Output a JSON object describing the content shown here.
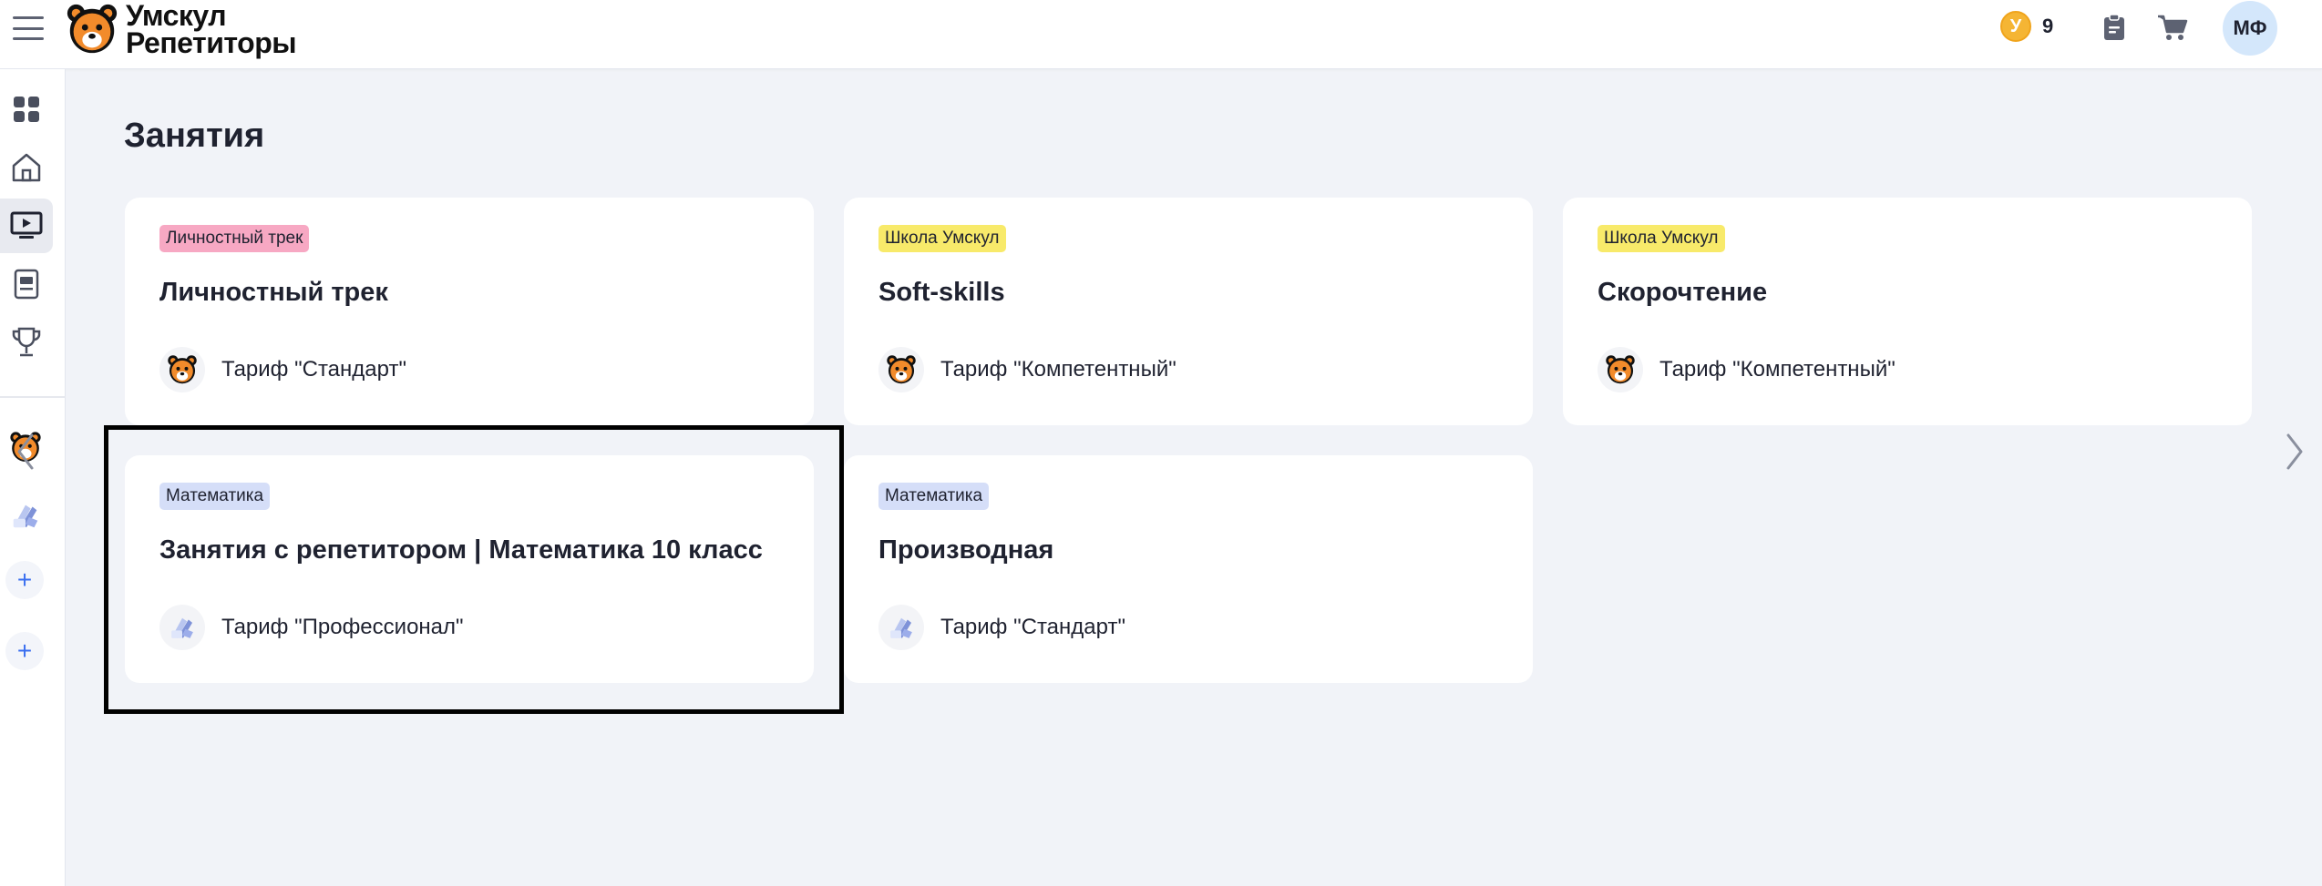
{
  "header": {
    "logo_line1": "Умскул",
    "logo_line2": "Репетиторы",
    "coin_symbol": "У",
    "coins": "9",
    "avatar_initials": "МФ"
  },
  "colors": {
    "accent": "#3a6ff0",
    "tag_pink": "#f7a8c3",
    "tag_yellow": "#f8ea6a",
    "tag_blue": "#d5def8",
    "coin": "#f5b534"
  },
  "page": {
    "title": "Занятия"
  },
  "cards": [
    {
      "tag": "Личностный трек",
      "title": "Личностный трек",
      "tariff": "Тариф \"Стандарт\"",
      "icon": "bear-icon"
    },
    {
      "tag": "Школа Умскул",
      "title": "Soft-skills",
      "tariff": "Тариф \"Компетентный\"",
      "icon": "bear-icon"
    },
    {
      "tag": "Школа Умскул",
      "title": "Скорочтение",
      "tariff": "Тариф \"Компетентный\"",
      "icon": "bear-icon"
    },
    {
      "tag": "Математика",
      "title": "Занятия с репетитором | Математика 10 класс",
      "tariff": "Тариф \"Профессионал\"",
      "icon": "math-tutor-icon"
    },
    {
      "tag": "Математика",
      "title": "Производная",
      "tariff": "Тариф \"Стандарт\"",
      "icon": "math-tutor-icon"
    }
  ],
  "sidebar": {
    "items": [
      "dashboard-icon",
      "home-icon",
      "lessons-icon",
      "notebook-icon",
      "trophy-icon"
    ],
    "active": "lessons-icon",
    "plus_label": "+"
  }
}
